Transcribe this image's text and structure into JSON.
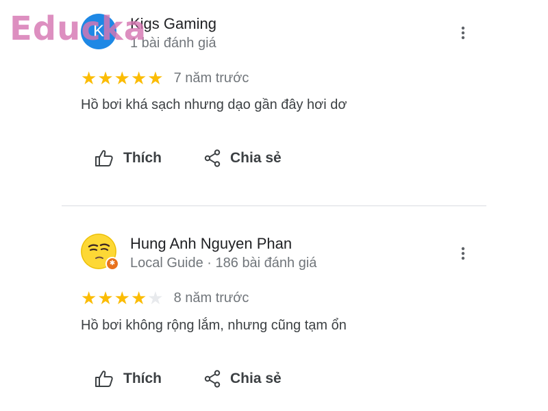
{
  "brand": {
    "watermark": "Educka",
    "color": "#d676b2"
  },
  "colors": {
    "star": "#fbbc04",
    "star_empty": "#e8eaed",
    "avatar_k": "#1e88e5"
  },
  "reviews": [
    {
      "avatar_letter": "K",
      "author": "Kigs Gaming",
      "meta": "1 bài đánh giá",
      "rating": 5,
      "max_rating": 5,
      "time": "7 năm trước",
      "text": "Hồ bơi khá sạch nhưng dạo gần đây hơi dơ",
      "like_label": "Thích",
      "share_label": "Chia sẻ"
    },
    {
      "avatar_icon": "yellow-face-avatar",
      "author": "Hung Anh Nguyen Phan",
      "meta": "Local Guide · 186 bài đánh giá",
      "rating": 4,
      "max_rating": 5,
      "time": "8 năm trước",
      "text": "Hồ bơi không rộng lắm, nhưng cũng tạm ổn",
      "like_label": "Thích",
      "share_label": "Chia sẻ"
    }
  ]
}
